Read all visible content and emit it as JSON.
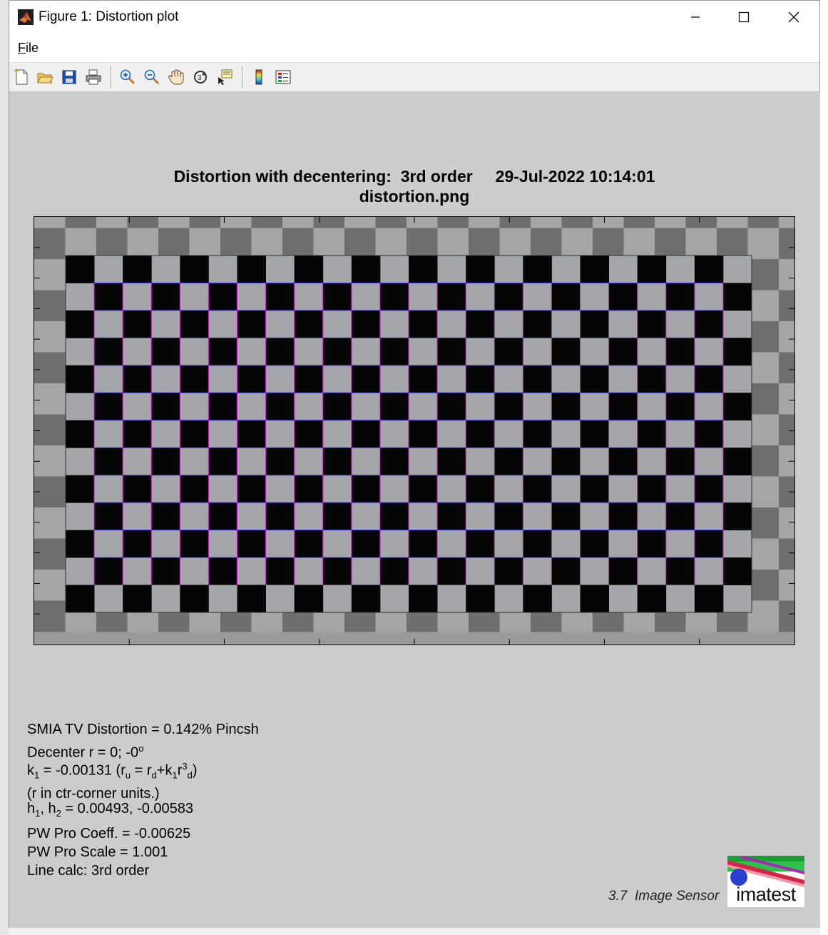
{
  "window": {
    "title": "Figure 1: Distortion plot",
    "controls": [
      "minimize",
      "maximize",
      "close"
    ]
  },
  "menu": {
    "file_underline": "F",
    "file_rest": "ile"
  },
  "toolbar": {
    "buttons": [
      "new-figure-icon",
      "open-file-icon",
      "save-icon",
      "print-icon",
      "zoom-in-icon",
      "zoom-out-icon",
      "pan-icon",
      "rotate-3d-icon",
      "data-cursor-icon",
      "colorbar-icon",
      "legend-icon"
    ]
  },
  "plot": {
    "title_line1": "Distortion with decentering:  3rd order     29-Jul-2022 10:14:01",
    "title_line2": "distortion.png"
  },
  "checker": {
    "cols": 24,
    "rows": 13,
    "dark": "#050505",
    "light": "#a5a6aa",
    "outer_dark": "#6e6e6e",
    "outer_light": "#a5a5a5",
    "grid_line": "#cc22cc"
  },
  "stats": {
    "smia": "SMIA TV Distortion = 0.142% Pincsh",
    "decenter_pre": "Decenter r = 0;  -0",
    "decenter_sup": "o",
    "k1_k": "k",
    "k1_sub": "1",
    "k1_value": " = -0.00131  (r",
    "k1_ru_sub": "u",
    "k1_eq": " = r",
    "k1_rd_sub": "d",
    "k1_plus": "+k",
    "k1_k_sub": "1",
    "k1_r": "r",
    "k1_exp": "3",
    "k1_rd2_sub": "d",
    "k1_close": ")",
    "units": "(r in ctr-corner units.)",
    "h_h1": "h",
    "h_sub1": "1",
    "h_comma": ", h",
    "h_sub2": "2",
    "h_values": " = 0.00493, -0.00583",
    "pw_coeff": "PW Pro Coeff. = -0.00625",
    "pw_scale": "PW Pro Scale = 1.001",
    "line_calc": "Line calc: 3rd order"
  },
  "footer": {
    "version": "3.7",
    "module": "Image Sensor",
    "logo_text": "imatest"
  }
}
